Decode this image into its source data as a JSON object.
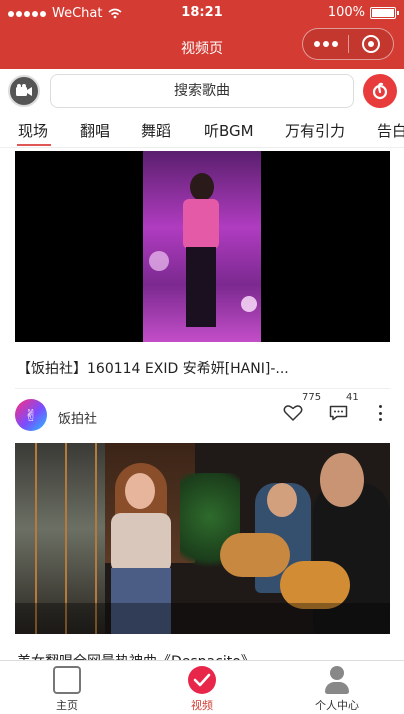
{
  "status_bar": {
    "carrier": "WeChat",
    "time": "18:21",
    "battery": "100%",
    "battery_level": 1.0
  },
  "nav_bar": {
    "title": "视频页"
  },
  "search": {
    "placeholder": "搜索歌曲"
  },
  "tabs": [
    {
      "label": "现场",
      "active": true
    },
    {
      "label": "翻唱",
      "active": false
    },
    {
      "label": "舞蹈",
      "active": false
    },
    {
      "label": "听BGM",
      "active": false
    },
    {
      "label": "万有引力",
      "active": false
    },
    {
      "label": "告白",
      "active": false
    }
  ],
  "cards": [
    {
      "title": "【饭拍社】160114 EXID 安希妍[HANI]-...",
      "author": "饭拍社",
      "likes": "775",
      "comments": "41"
    },
    {
      "title": "美女翻唱全网最热神曲《Despacito》"
    }
  ],
  "bottom_nav": [
    {
      "label": "主页",
      "icon": "home-icon",
      "active": false
    },
    {
      "label": "视频",
      "icon": "video-check-icon",
      "active": true
    },
    {
      "label": "个人中心",
      "icon": "user-icon",
      "active": false
    }
  ],
  "colors": {
    "brand_red": "#d43c33",
    "active_tab_underline": "#e05555",
    "video_tab_icon": "#e8264a"
  }
}
